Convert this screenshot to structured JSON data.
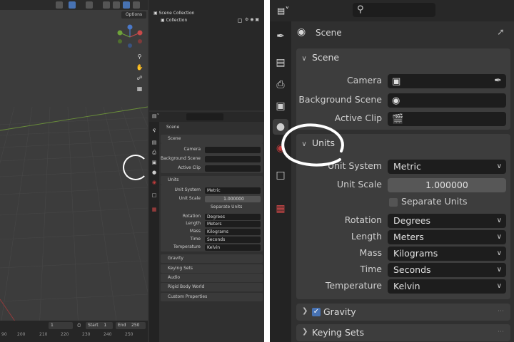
{
  "left_view": {
    "viewport": {
      "options_label": "Options"
    },
    "outliner": {
      "items": [
        "Scene Collection",
        "Collection"
      ]
    },
    "properties": {
      "context_title": "Scene",
      "scene_panel": {
        "title": "Scene",
        "camera_label": "Camera",
        "background_scene_label": "Background Scene",
        "active_clip_label": "Active Clip"
      },
      "units_panel": {
        "title": "Units",
        "unit_system_label": "Unit System",
        "unit_system_value": "Metric",
        "unit_scale_label": "Unit Scale",
        "unit_scale_value": "1.000000",
        "separate_units_label": "Separate Units",
        "rotation_label": "Rotation",
        "rotation_value": "Degrees",
        "length_label": "Length",
        "length_value": "Meters",
        "mass_label": "Mass",
        "mass_value": "Kilograms",
        "time_label": "Time",
        "time_value": "Seconds",
        "temperature_label": "Temperature",
        "temperature_value": "Kelvin"
      },
      "collapsed_panels": [
        "Gravity",
        "Keying Sets",
        "Audio",
        "Rigid Body World",
        "Custom Properties"
      ]
    },
    "timeline": {
      "current_frame": "1",
      "start_label": "Start",
      "start_value": "1",
      "end_label": "End",
      "end_value": "250",
      "ruler_numbers": [
        "90",
        "200",
        "210",
        "220",
        "230",
        "240",
        "250"
      ]
    }
  },
  "right_view": {
    "context_title": "Scene",
    "scene_panel": {
      "title": "Scene",
      "camera_label": "Camera",
      "background_scene_label": "Background Scene",
      "active_clip_label": "Active Clip"
    },
    "units_panel": {
      "title": "Units",
      "unit_system_label": "Unit System",
      "unit_system_value": "Metric",
      "unit_scale_label": "Unit Scale",
      "unit_scale_value": "1.000000",
      "separate_units_label": "Separate Units",
      "rotation_label": "Rotation",
      "rotation_value": "Degrees",
      "length_label": "Length",
      "length_value": "Meters",
      "mass_label": "Mass",
      "mass_value": "Kilograms",
      "time_label": "Time",
      "time_value": "Seconds",
      "temperature_label": "Temperature",
      "temperature_value": "Kelvin"
    },
    "gravity_panel": {
      "title": "Gravity",
      "enabled": true
    },
    "keying_sets_panel": {
      "title": "Keying Sets"
    }
  },
  "icons": {
    "editor_type": "properties-editor-icon",
    "search": "search-icon",
    "pin": "pin-icon",
    "tabs": [
      "tool-tab-icon",
      "render-tab-icon",
      "output-tab-icon",
      "view-layer-tab-icon",
      "scene-tab-icon",
      "world-tab-icon",
      "collection-tab-icon",
      "texture-tab-icon"
    ]
  },
  "colors": {
    "accent": "#4772b3",
    "annotation": "#ffffff",
    "world_tab": "#c13b3b",
    "texture_tab": "#d04848"
  }
}
